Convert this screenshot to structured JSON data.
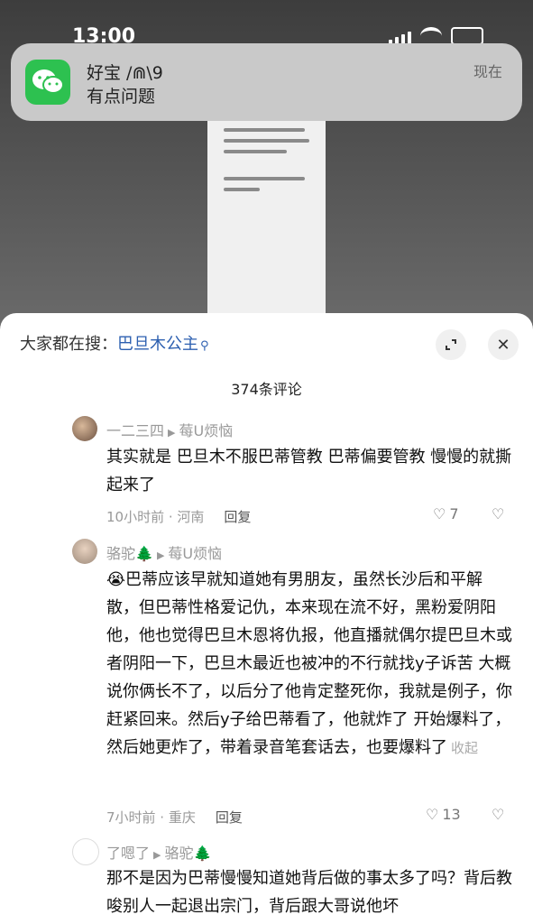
{
  "status": {
    "time": "13:00"
  },
  "notification": {
    "app": "WeChat",
    "title": "好宝 /⋒\\9",
    "body": "有点问题",
    "time": "现在"
  },
  "sheet": {
    "search_prefix": "大家都在搜：",
    "search_term": "巴旦木公主",
    "comment_count": "374条评论"
  },
  "comments": [
    {
      "author": "一二三四",
      "reply_to": "莓U烦恼",
      "text": "其实就是 巴旦木不服巴蒂管教  巴蒂偏要管教  慢慢的就撕起来了",
      "time_loc": "10小时前 · 河南",
      "reply_label": "回复",
      "likes": "7"
    },
    {
      "author": "骆驼🌲",
      "reply_to": "莓U烦恼",
      "text": "😭巴蒂应该早就知道她有男朋友，虽然长沙后和平解散，但巴蒂性格爱记仇，本来现在流不好，黑粉爱阴阳他，他也觉得巴旦木恩将仇报，他直播就偶尔提巴旦木或者阴阳一下，巴旦木最近也被冲的不行就找y子诉苦 大概说你俩长不了，以后分了他肯定整死你，我就是例子，你赶紧回来。然后y子给巴蒂看了，他就炸了 开始爆料了，然后她更炸了，带着录音笔套话去，也要爆料了",
      "collapse_label": "收起",
      "time_loc": "7小时前 · 重庆",
      "reply_label": "回复",
      "likes": "13"
    },
    {
      "author": "了嗯了",
      "reply_to": "骆驼🌲",
      "text": "那不是因为巴蒂慢慢知道她背后做的事太多了吗？背后教唆别人一起退出宗门，背后跟大哥说他坏"
    }
  ]
}
